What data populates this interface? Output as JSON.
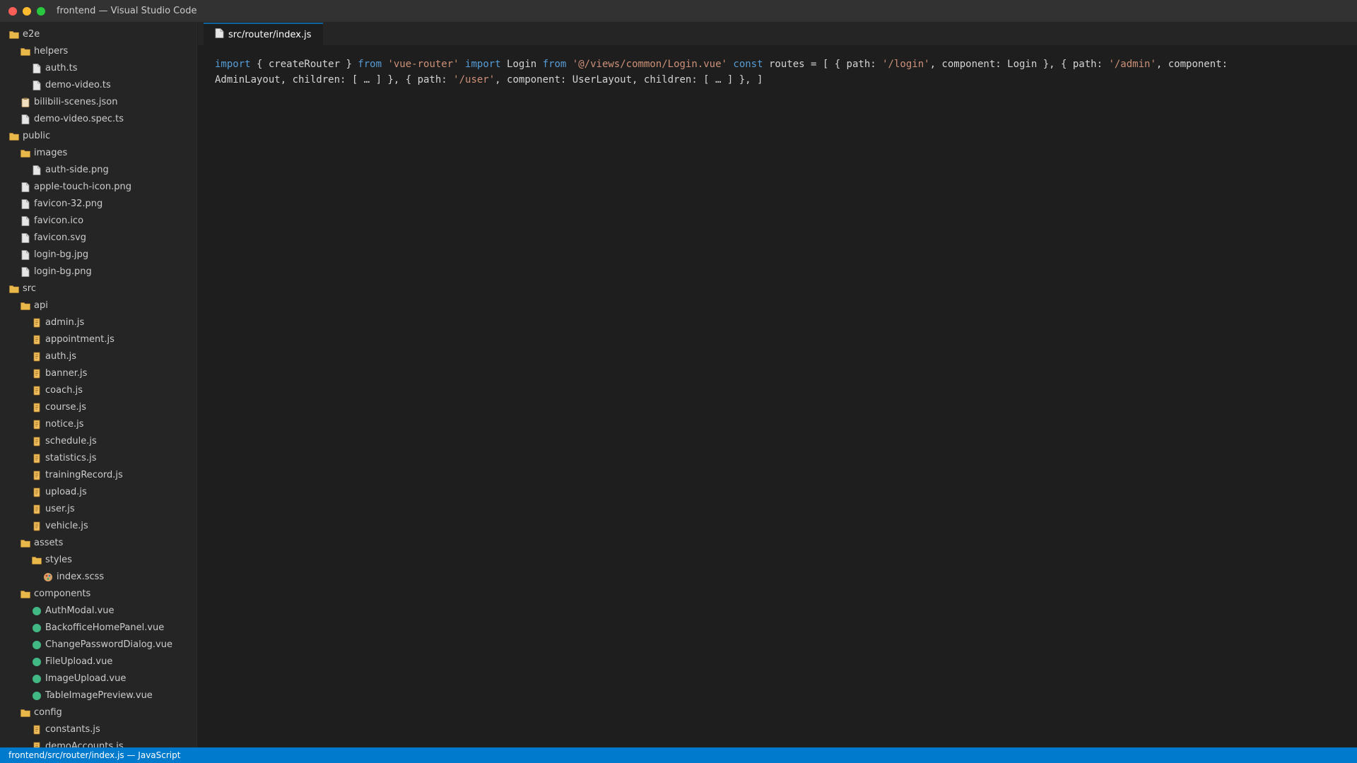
{
  "window": {
    "title": "frontend — Visual Studio Code"
  },
  "colors": {
    "titlebar": "#323233",
    "sidebar": "#252526",
    "editor": "#1e1e1e",
    "statusbar": "#007acc",
    "keyword": "#569cd6",
    "string": "#ce9178",
    "folder": "#e8b84a",
    "vue": "#41b883",
    "js": "#e0a030"
  },
  "explorer": {
    "items": [
      {
        "label": "e2e",
        "level": 0,
        "icon": "folder-icon"
      },
      {
        "label": "helpers",
        "level": 1,
        "icon": "folder-icon"
      },
      {
        "label": "auth.ts",
        "level": 2,
        "icon": "file-icon"
      },
      {
        "label": "demo-video.ts",
        "level": 2,
        "icon": "file-icon"
      },
      {
        "label": "bilibili-scenes.json",
        "level": 1,
        "icon": "json-file-icon"
      },
      {
        "label": "demo-video.spec.ts",
        "level": 1,
        "icon": "file-icon"
      },
      {
        "label": "public",
        "level": 0,
        "icon": "folder-icon"
      },
      {
        "label": "images",
        "level": 1,
        "icon": "folder-icon"
      },
      {
        "label": "auth-side.png",
        "level": 2,
        "icon": "file-icon"
      },
      {
        "label": "apple-touch-icon.png",
        "level": 1,
        "icon": "file-icon"
      },
      {
        "label": "favicon-32.png",
        "level": 1,
        "icon": "file-icon"
      },
      {
        "label": "favicon.ico",
        "level": 1,
        "icon": "file-icon"
      },
      {
        "label": "favicon.svg",
        "level": 1,
        "icon": "file-icon"
      },
      {
        "label": "login-bg.jpg",
        "level": 1,
        "icon": "file-icon"
      },
      {
        "label": "login-bg.png",
        "level": 1,
        "icon": "file-icon"
      },
      {
        "label": "src",
        "level": 0,
        "icon": "folder-icon"
      },
      {
        "label": "api",
        "level": 1,
        "icon": "folder-icon"
      },
      {
        "label": "admin.js",
        "level": 2,
        "icon": "js-file-icon"
      },
      {
        "label": "appointment.js",
        "level": 2,
        "icon": "js-file-icon"
      },
      {
        "label": "auth.js",
        "level": 2,
        "icon": "js-file-icon"
      },
      {
        "label": "banner.js",
        "level": 2,
        "icon": "js-file-icon"
      },
      {
        "label": "coach.js",
        "level": 2,
        "icon": "js-file-icon"
      },
      {
        "label": "course.js",
        "level": 2,
        "icon": "js-file-icon"
      },
      {
        "label": "notice.js",
        "level": 2,
        "icon": "js-file-icon"
      },
      {
        "label": "schedule.js",
        "level": 2,
        "icon": "js-file-icon"
      },
      {
        "label": "statistics.js",
        "level": 2,
        "icon": "js-file-icon"
      },
      {
        "label": "trainingRecord.js",
        "level": 2,
        "icon": "js-file-icon"
      },
      {
        "label": "upload.js",
        "level": 2,
        "icon": "js-file-icon"
      },
      {
        "label": "user.js",
        "level": 2,
        "icon": "js-file-icon"
      },
      {
        "label": "vehicle.js",
        "level": 2,
        "icon": "js-file-icon"
      },
      {
        "label": "assets",
        "level": 1,
        "icon": "folder-icon"
      },
      {
        "label": "styles",
        "level": 2,
        "icon": "folder-icon"
      },
      {
        "label": "index.scss",
        "level": 3,
        "icon": "scss-file-icon"
      },
      {
        "label": "components",
        "level": 1,
        "icon": "folder-icon"
      },
      {
        "label": "AuthModal.vue",
        "level": 2,
        "icon": "vue-file-icon"
      },
      {
        "label": "BackofficeHomePanel.vue",
        "level": 2,
        "icon": "vue-file-icon"
      },
      {
        "label": "ChangePasswordDialog.vue",
        "level": 2,
        "icon": "vue-file-icon"
      },
      {
        "label": "FileUpload.vue",
        "level": 2,
        "icon": "vue-file-icon"
      },
      {
        "label": "ImageUpload.vue",
        "level": 2,
        "icon": "vue-file-icon"
      },
      {
        "label": "TableImagePreview.vue",
        "level": 2,
        "icon": "vue-file-icon"
      },
      {
        "label": "config",
        "level": 1,
        "icon": "folder-icon"
      },
      {
        "label": "constants.js",
        "level": 2,
        "icon": "js-file-icon"
      },
      {
        "label": "demoAccounts.js",
        "level": 2,
        "icon": "js-file-icon"
      }
    ]
  },
  "editor": {
    "tab_label": "src/router/index.js",
    "code_tokens": [
      {
        "t": "import",
        "c": "kw"
      },
      {
        "t": " { createRouter } ",
        "c": ""
      },
      {
        "t": "from",
        "c": "kw"
      },
      {
        "t": " ",
        "c": ""
      },
      {
        "t": "'vue-router'",
        "c": "str"
      },
      {
        "t": " ",
        "c": ""
      },
      {
        "t": "import",
        "c": "kw"
      },
      {
        "t": " Login ",
        "c": ""
      },
      {
        "t": "from",
        "c": "kw"
      },
      {
        "t": " ",
        "c": ""
      },
      {
        "t": "'@/views/common/Login.vue'",
        "c": "str"
      },
      {
        "t": " ",
        "c": ""
      },
      {
        "t": "const",
        "c": "kw"
      },
      {
        "t": " routes = [ { path: ",
        "c": ""
      },
      {
        "t": "'/login'",
        "c": "str"
      },
      {
        "t": ", component: Login }, { path: ",
        "c": ""
      },
      {
        "t": "'/admin'",
        "c": "str"
      },
      {
        "t": ", component: AdminLayout, children: [ … ] }, { path: ",
        "c": ""
      },
      {
        "t": "'/user'",
        "c": "str"
      },
      {
        "t": ", component: UserLayout, children: [ … ] }, ]",
        "c": ""
      }
    ]
  },
  "statusbar": {
    "text": "frontend/src/router/index.js — JavaScript"
  }
}
